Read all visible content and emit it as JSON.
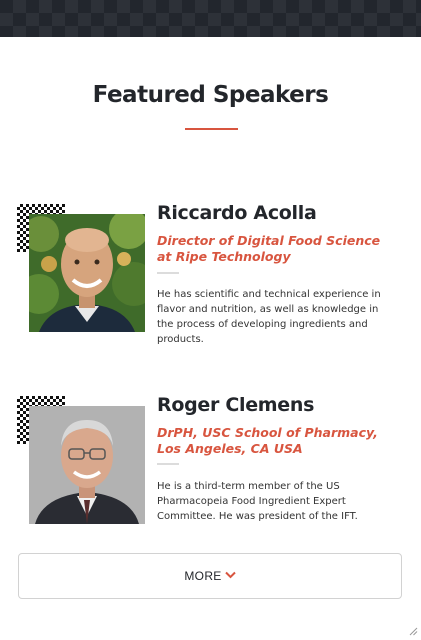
{
  "section": {
    "title": "Featured Speakers"
  },
  "speakers": [
    {
      "name": "Riccardo Acolla",
      "role": "Director of Digital Food Science at Ripe Technology",
      "bio": "He has scientific and technical experience in flavor and nutrition, as well as knowledge in the process of developing ingredients and products."
    },
    {
      "name": "Roger Clemens",
      "role": "DrPH, USC School of Pharmacy, Los Angeles, CA USA",
      "bio": "He is a third-term member of the US Pharmacopeia Food Ingredient Expert Committee. He was president of the IFT."
    }
  ],
  "more_button": {
    "label": "MORE",
    "icon": "chevron-down-icon"
  },
  "colors": {
    "accent": "#d8553f",
    "header_bg": "#22262d",
    "text": "#23262b"
  }
}
